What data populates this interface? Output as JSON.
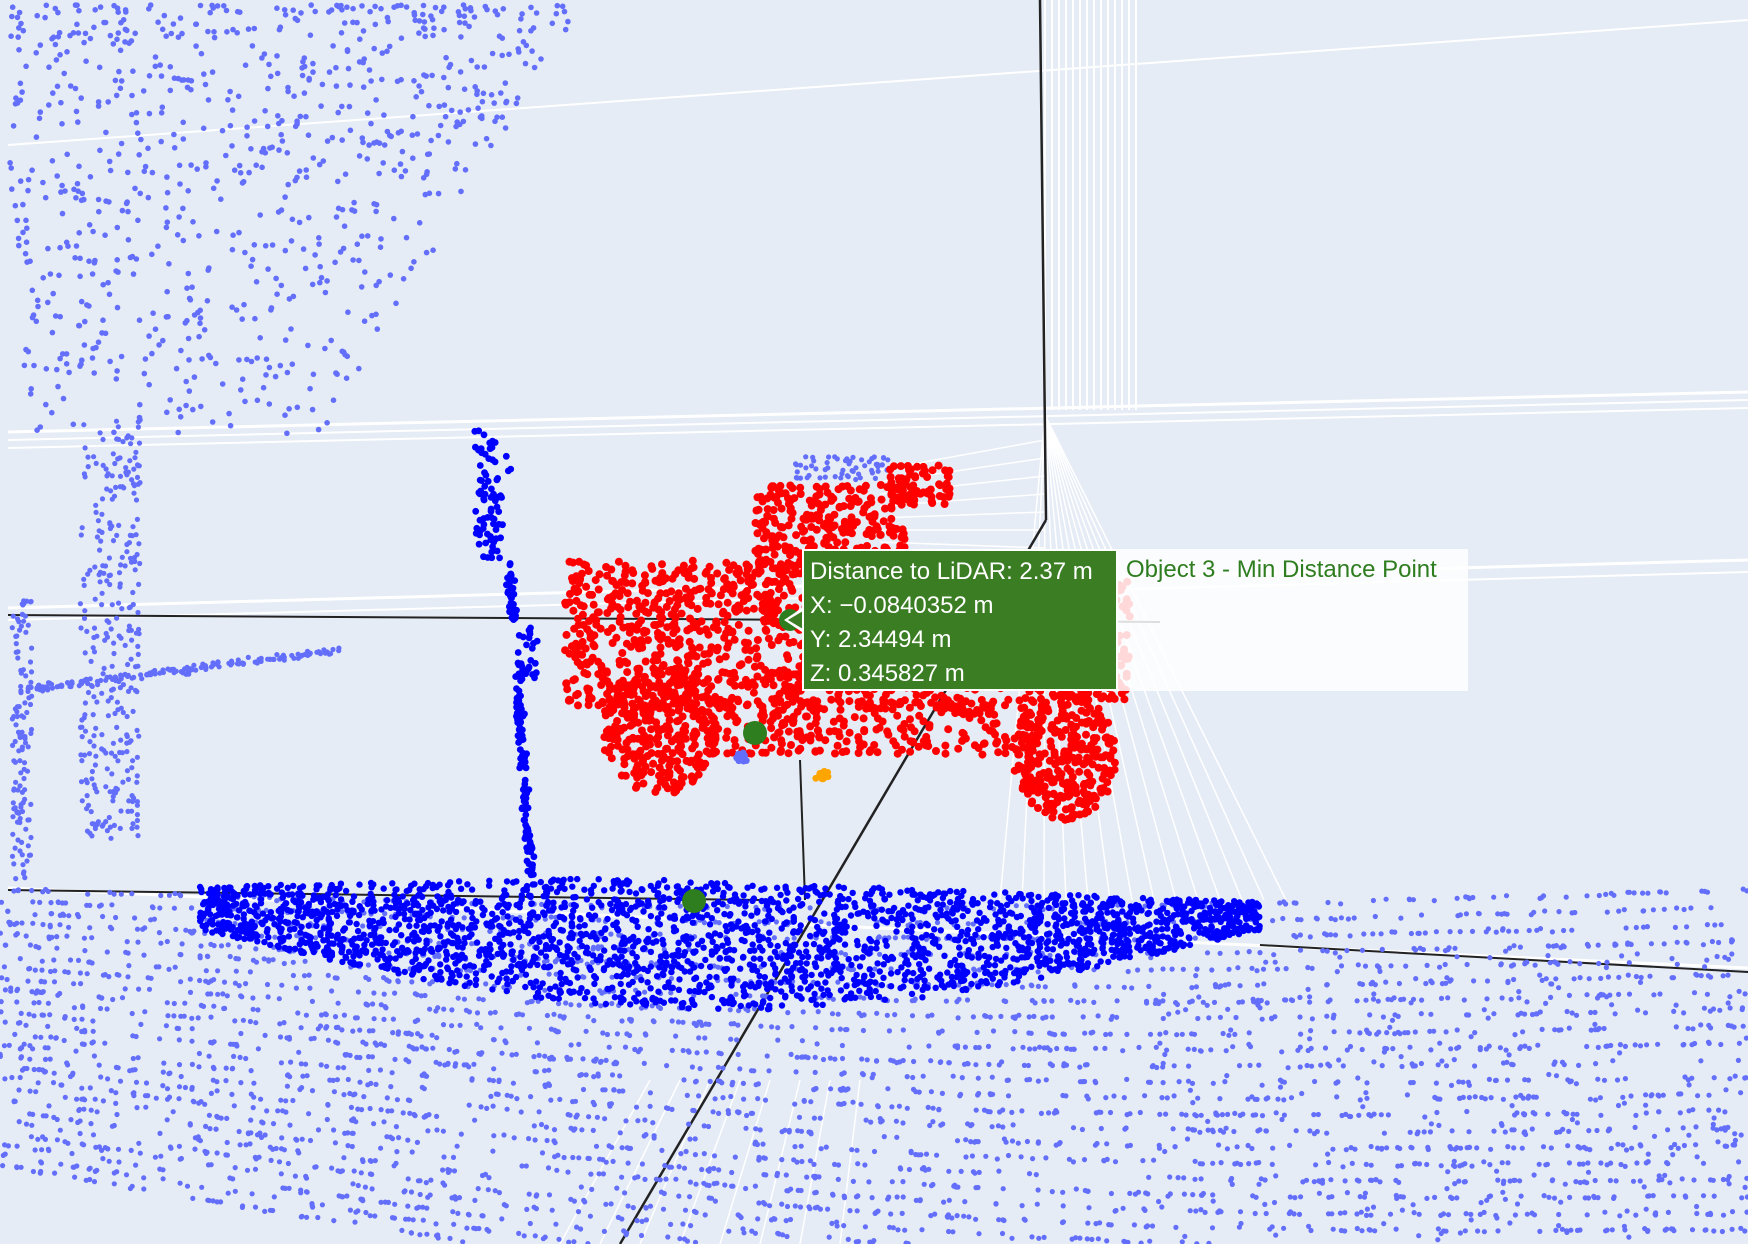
{
  "colors": {
    "background": "#e5ecf6",
    "grid": "#ffffff",
    "axis": "#222222",
    "background_points": "#636efa",
    "ground_object": "#0000ff",
    "vehicle_object": "#ff0000",
    "min_distance_marker": "#2e7d1f",
    "small_object": "#ffa500",
    "tooltip_bg": "#3a7d23",
    "tooltip_name": "#2e7d1f"
  },
  "hover_tooltip": {
    "trace_name": "Object 3 - Min Distance Point",
    "lines": [
      "Distance to LiDAR: 2.37 m",
      "X: −0.0840352 m",
      "Y: 2.34494 m",
      "Z: 0.345827 m"
    ]
  },
  "chart_data": {
    "type": "scatter",
    "dimensions": "3d",
    "grid": true,
    "series": [
      {
        "name": "Object 3 - Min Distance Point",
        "color": "#2e7d1f",
        "points": [
          {
            "x": -0.0840352,
            "y": 2.34494,
            "z": 0.345827,
            "distance": 2.37
          }
        ]
      }
    ]
  }
}
